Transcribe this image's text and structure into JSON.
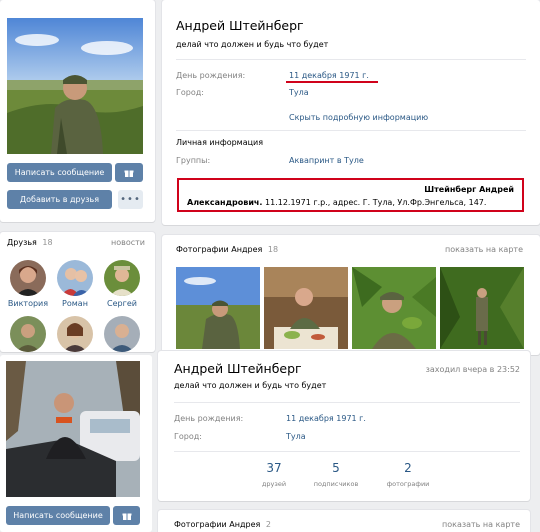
{
  "profile_top": {
    "name": "Андрей Штейнберг",
    "status": "делай что должен и будь что будет",
    "birthday_label": "День рождения:",
    "birthday_value": "11 декабря 1971 г.",
    "city_label": "Город:",
    "city_value": "Тула",
    "more_info_link": "Скрыть подробную информацию",
    "personal_header": "Личная информация",
    "groups_label": "Группы:",
    "groups_value": "Аквапринт в Туле",
    "note_line1": "Штейнберг Андрей",
    "note_line2_bold": "Александрович.",
    "note_line2_rest": "11.12.1971 г.р., адрес. Г. Тула, Ул.Фр.Энгельса, 147."
  },
  "left_top": {
    "message_button": "Написать сообщение",
    "add_friend_button": "Добавить в друзья",
    "more_dots": "•••"
  },
  "friends": {
    "title": "Друзья",
    "count": "18",
    "news_link": "новости",
    "items": [
      {
        "name": "Виктория"
      },
      {
        "name": "Роман"
      },
      {
        "name": "Сергей"
      }
    ]
  },
  "photos_top": {
    "title": "Фотографии Андрея",
    "count": "18",
    "map_link": "показать на карте"
  },
  "profile_bottom": {
    "name": "Андрей Штейнберг",
    "last_seen": "заходил вчера в 23:52",
    "status": "делай что должен и будь что будет",
    "birthday_label": "День рождения:",
    "birthday_value": "11 декабря 1971 г.",
    "city_label": "Город:",
    "city_value": "Тула",
    "counters": [
      {
        "num": "37",
        "label": "друзей"
      },
      {
        "num": "5",
        "label": "подписчиков"
      },
      {
        "num": "2",
        "label": "фотографии"
      }
    ]
  },
  "left_bottom": {
    "message_button": "Написать сообщение"
  },
  "photos_bottom": {
    "title": "Фотографии Андрея",
    "count": "2",
    "map_link": "показать на карте"
  },
  "colors": {
    "accent": "#5e81a8",
    "link": "#2a5885",
    "highlight_red": "#d0021b"
  }
}
